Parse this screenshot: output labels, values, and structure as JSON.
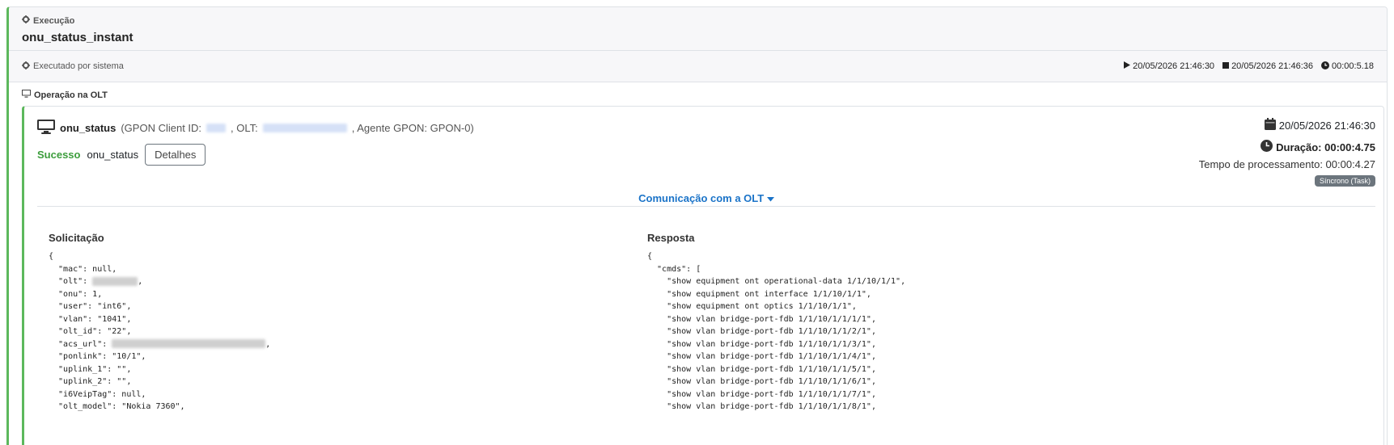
{
  "header": {
    "label": "Execução",
    "title": "onu_status_instant"
  },
  "exec": {
    "by": "Executado por sistema",
    "start": "20/05/2026 21:46:30",
    "end": "20/05/2026 21:46:36",
    "elapsed": "00:00:5.18"
  },
  "operation_section": {
    "title": "Operação na OLT"
  },
  "operation": {
    "name": "onu_status",
    "gpon_label": "(GPON Client ID:",
    "olt_label": ", OLT:",
    "agent_text": ", Agente GPON: GPON-0)",
    "status": "Sucesso",
    "command": "onu_status",
    "details_button": "Detalhes",
    "date": "20/05/2026 21:46:30",
    "duration_label": "Duração: 00:00:4.75",
    "processing_label": "Tempo de processamento: 00:00:4.27",
    "mode_badge": "Síncrono (Task)",
    "communication_toggle": "Comunicação com a OLT"
  },
  "request": {
    "title": "Solicitação",
    "lines": [
      "{",
      "  \"mac\": null,",
      "  \"olt\": ",
      "  \"onu\": 1,",
      "  \"user\": \"int6\",",
      "  \"vlan\": \"1041\",",
      "  \"olt_id\": \"22\",",
      "  \"acs_url\": ",
      "  \"ponlink\": \"10/1\",",
      "  \"uplink_1\": \"\",",
      "  \"uplink_2\": \"\",",
      "  \"i6VeipTag\": null,",
      "  \"olt_model\": \"Nokia 7360\","
    ]
  },
  "response": {
    "title": "Resposta",
    "lines": [
      "{",
      "  \"cmds\": [",
      "    \"show equipment ont operational-data 1/1/10/1/1\",",
      "    \"show equipment ont interface 1/1/10/1/1\",",
      "    \"show equipment ont optics 1/1/10/1/1\",",
      "    \"show vlan bridge-port-fdb 1/1/10/1/1/1/1\",",
      "    \"show vlan bridge-port-fdb 1/1/10/1/1/2/1\",",
      "    \"show vlan bridge-port-fdb 1/1/10/1/1/3/1\",",
      "    \"show vlan bridge-port-fdb 1/1/10/1/1/4/1\",",
      "    \"show vlan bridge-port-fdb 1/1/10/1/1/5/1\",",
      "    \"show vlan bridge-port-fdb 1/1/10/1/1/6/1\",",
      "    \"show vlan bridge-port-fdb 1/1/10/1/1/7/1\",",
      "    \"show vlan bridge-port-fdb 1/1/10/1/1/8/1\","
    ]
  },
  "colors": {
    "success": "#3c9d3c",
    "link": "#1a73c8",
    "border_accent": "#5cb85c"
  }
}
